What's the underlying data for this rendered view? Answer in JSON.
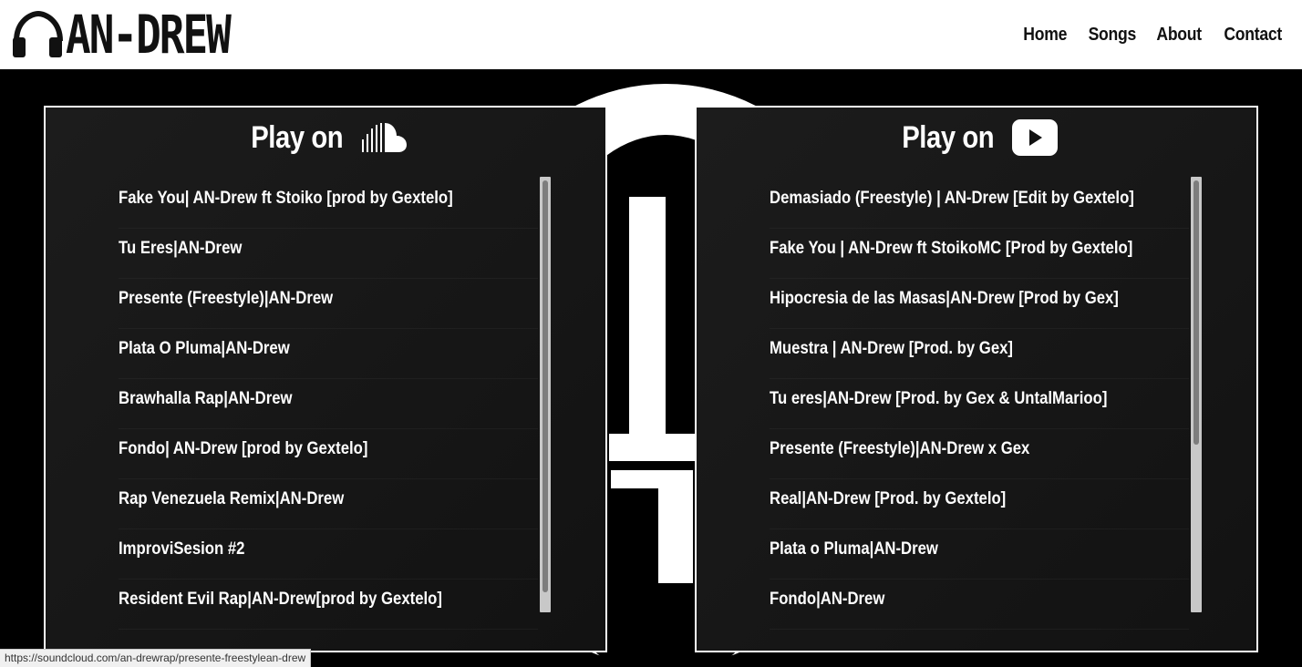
{
  "brand": {
    "logo_text": "AN-DREW",
    "logo_icon": "headphones-icon"
  },
  "nav": [
    "Home",
    "Songs",
    "About",
    "Contact"
  ],
  "soundcloud": {
    "heading": "Play on",
    "icon": "soundcloud-icon",
    "tracks": [
      "Fake You| AN-Drew ft Stoiko [prod by Gextelo]",
      "Tu Eres|AN-Drew",
      "Presente (Freestyle)|AN-Drew",
      "Plata O Pluma|AN-Drew",
      "Brawhalla Rap|AN-Drew",
      "Fondo| AN-Drew [prod by Gextelo]",
      "Rap Venezuela Remix|AN-Drew",
      "ImproviSesion #2",
      "Resident Evil Rap|AN-Drew[prod by Gextelo]"
    ]
  },
  "youtube": {
    "heading": "Play on",
    "icon": "youtube-icon",
    "tracks": [
      "Demasiado (Freestyle) | AN-Drew [Edit by Gextelo]",
      "Fake You | AN-Drew ft StoikoMC [Prod by Gextelo]",
      "Hipocresia de las Masas|AN-Drew [Prod by Gex]",
      "Muestra | AN-Drew [Prod. by Gex]",
      "Tu eres|AN-Drew [Prod. by Gex & UntalMarioo]",
      "Presente (Freestyle)|AN-Drew x Gex",
      "Real|AN-Drew [Prod. by Gextelo]",
      "Plata o Pluma|AN-Drew",
      "Fondo|AN-Drew"
    ]
  },
  "status_url": "https://soundcloud.com/an-drewrap/presente-freestylean-drew",
  "colors": {
    "background": "#000000",
    "header": "#ffffff",
    "panel": "#181818",
    "text": "#ffffff"
  }
}
